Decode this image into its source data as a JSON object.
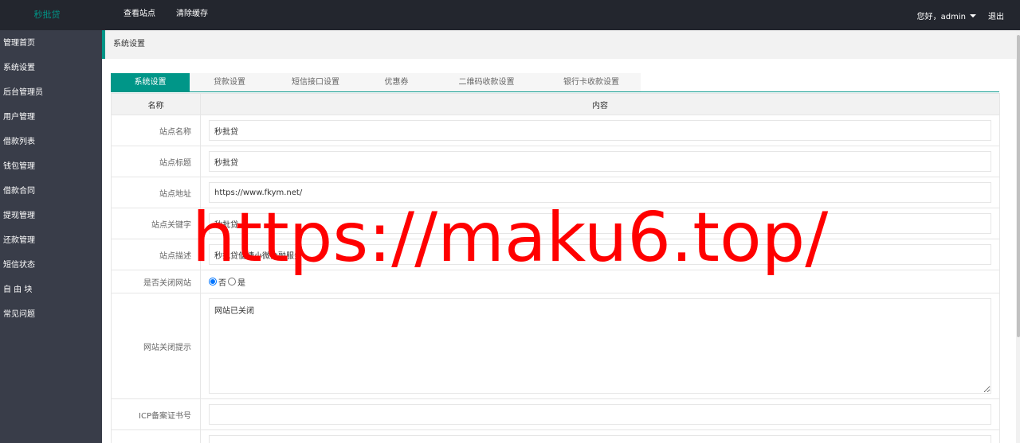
{
  "header": {
    "logo": "秒批贷",
    "nav": [
      "查看站点",
      "清除缓存"
    ],
    "greeting": "您好，admin",
    "logout": "退出"
  },
  "sidebar": {
    "items": [
      "管理首页",
      "系统设置",
      "后台管理员",
      "用户管理",
      "借款列表",
      "钱包管理",
      "借款合同",
      "提现管理",
      "还款管理",
      "短信状态",
      "自 由 块",
      "常见问题"
    ]
  },
  "breadcrumb": "系统设置",
  "tabs": [
    "系统设置",
    "贷款设置",
    "短信接口设置",
    "优惠券",
    "二维码收款设置",
    "银行卡收款设置"
  ],
  "active_tab": "系统设置",
  "table": {
    "col_name": "名称",
    "col_content": "内容",
    "rows": {
      "site_name": {
        "label": "站点名称",
        "value": "秒批贷"
      },
      "site_title": {
        "label": "站点标题",
        "value": "秒批贷"
      },
      "site_url": {
        "label": "站点地址",
        "value": "https://www.fkym.net/"
      },
      "site_keywords": {
        "label": "站点关键字",
        "value": "秒批贷"
      },
      "site_desc": {
        "label": "站点描述",
        "value": "秒批贷便捷小微金融服务"
      },
      "close_site": {
        "label": "是否关闭网站",
        "option_no": "否",
        "option_yes": "是",
        "selected": "否"
      },
      "close_notice": {
        "label": "网站关闭提示",
        "value": "网站已关闭"
      },
      "icp": {
        "label": "ICP备案证书号",
        "value": ""
      }
    }
  },
  "watermark": "https://maku6.top/",
  "colors": {
    "topbar": "#23262e",
    "sidebar": "#393d49",
    "accent": "#009688",
    "watermark": "#ff0000"
  }
}
